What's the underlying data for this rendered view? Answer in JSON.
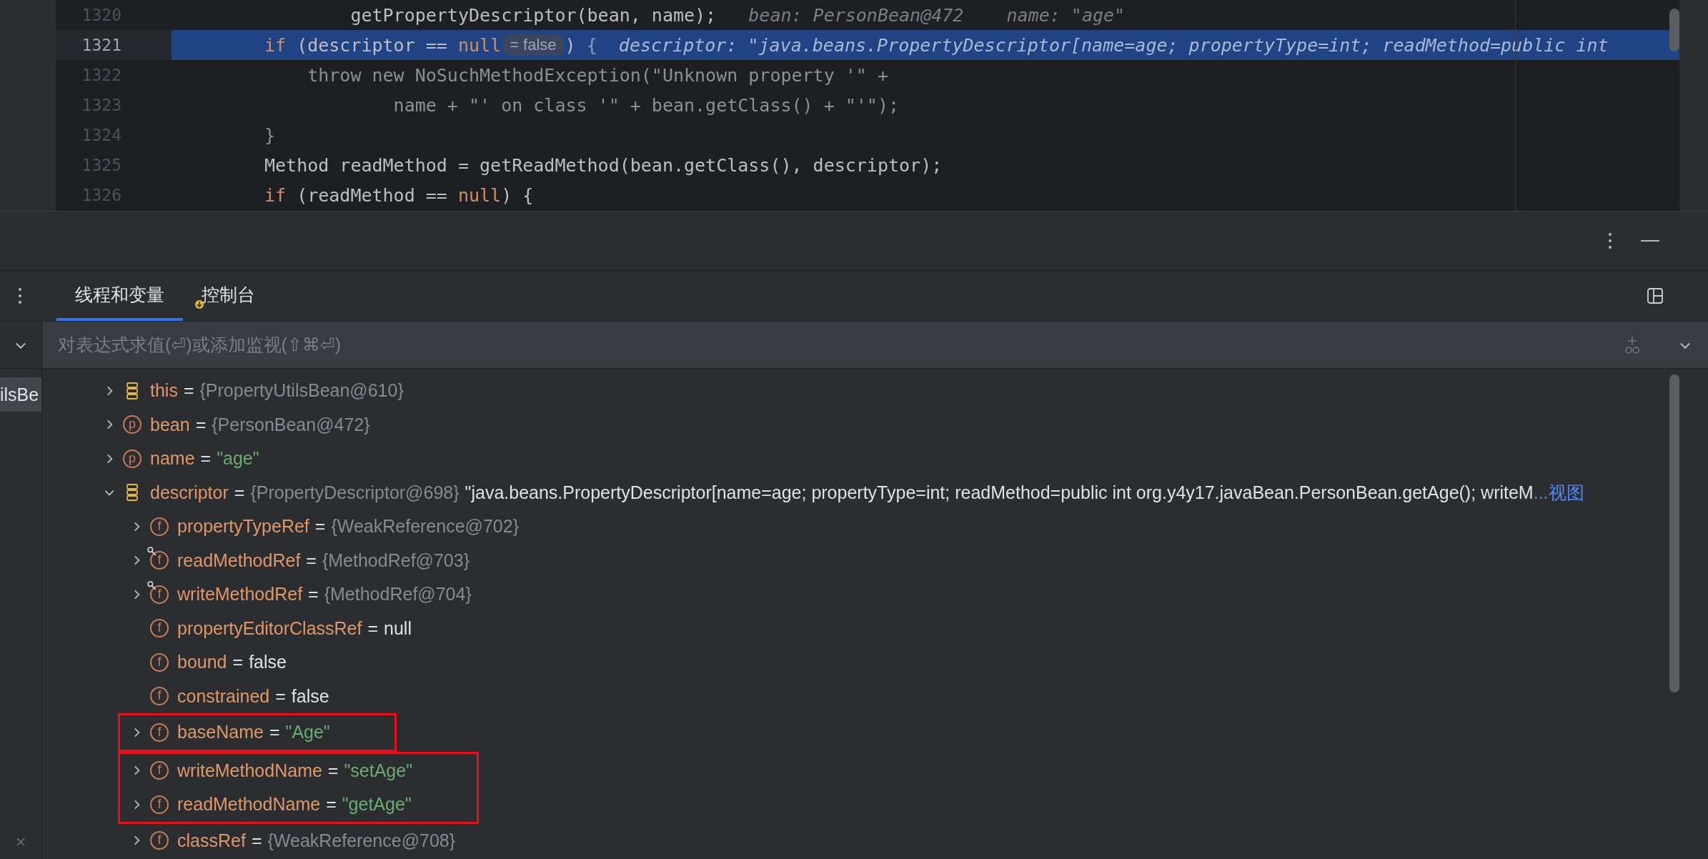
{
  "editor": {
    "lines": [
      {
        "number": "1320",
        "selected": false,
        "tokens": [
          {
            "kind": "code",
            "text": "        getPropertyDescriptor(bean, name);"
          },
          {
            "kind": "hint",
            "text": "   bean: PersonBean@472    name: \"age\""
          }
        ]
      },
      {
        "number": "1321",
        "selected": true,
        "tokens": [
          {
            "kind": "keyword",
            "text": "if"
          },
          {
            "kind": "code",
            "text": " (descriptor == "
          },
          {
            "kind": "keyword",
            "text": "null"
          },
          {
            "kind": "pill",
            "text": "= false"
          },
          {
            "kind": "code",
            "text": ") "
          },
          {
            "kind": "dim",
            "text": "{"
          },
          {
            "kind": "hint",
            "text": "  descriptor: \"java.beans.PropertyDescriptor[name=age; propertyType=int; readMethod=public int"
          }
        ]
      },
      {
        "number": "1322",
        "selected": false,
        "tokens": [
          {
            "kind": "dim",
            "text": "    throw new NoSuchMethodException(\"Unknown property '\" +"
          }
        ]
      },
      {
        "number": "1323",
        "selected": false,
        "tokens": [
          {
            "kind": "dim",
            "text": "            name + \"' on class '\" + bean.getClass() + \"'\");"
          }
        ]
      },
      {
        "number": "1324",
        "selected": false,
        "tokens": [
          {
            "kind": "dim",
            "text": "}"
          }
        ]
      },
      {
        "number": "1325",
        "selected": false,
        "tokens": [
          {
            "kind": "code",
            "text": "Method readMethod = getReadMethod(bean.getClass(), descriptor);"
          }
        ]
      },
      {
        "number": "1326",
        "selected": false,
        "tokens": [
          {
            "kind": "keyword",
            "text": "if"
          },
          {
            "kind": "code",
            "text": " (readMethod == "
          },
          {
            "kind": "keyword",
            "text": "null"
          },
          {
            "kind": "code",
            "text": ") {"
          }
        ]
      }
    ]
  },
  "tabs": [
    {
      "label": "线程和变量",
      "selected": true,
      "badge": false
    },
    {
      "label": "控制台",
      "selected": false,
      "badge": true
    }
  ],
  "watch": {
    "placeholder": "对表达式求值(⏎)或添加监视(⇧⌘⏎)"
  },
  "frames": [
    {
      "label": "ilsBe",
      "selected": true
    }
  ],
  "variables": [
    {
      "kind": "row",
      "icon": {
        "kind": "stack"
      },
      "name": "this",
      "operator": "=",
      "value": {
        "kind": "object",
        "text": "{PropertyUtilsBean@610}"
      },
      "expandable": true,
      "expanded": false,
      "badge": false
    },
    {
      "kind": "row",
      "icon": {
        "kind": "letter",
        "letter": "p"
      },
      "name": "bean",
      "operator": "=",
      "value": {
        "kind": "object",
        "text": "{PersonBean@472}"
      },
      "expandable": true,
      "expanded": false,
      "badge": false
    },
    {
      "kind": "row",
      "icon": {
        "kind": "letter",
        "letter": "p"
      },
      "name": "name",
      "operator": "=",
      "value": {
        "kind": "string",
        "text": "\"age\""
      },
      "expandable": true,
      "expanded": false,
      "badge": false
    },
    {
      "kind": "row",
      "icon": {
        "kind": "stack"
      },
      "name": "descriptor",
      "operator": "=",
      "value": {
        "kind": "object",
        "text": "{PropertyDescriptor@698}"
      },
      "description": "\"java.beans.PropertyDescriptor[name=age; propertyType=int; readMethod=public int org.y4y17.javaBean.PersonBean.getAge(); writeM",
      "more_link": "...视图",
      "expandable": true,
      "expanded": true,
      "badge": false,
      "children": [
        {
          "kind": "row",
          "icon": {
            "kind": "letter",
            "letter": "f"
          },
          "name": "propertyTypeRef",
          "operator": "=",
          "value": {
            "kind": "object",
            "text": "{WeakReference@702}"
          },
          "expandable": true,
          "expanded": false,
          "badge": false
        },
        {
          "kind": "row",
          "icon": {
            "kind": "letter",
            "letter": "f"
          },
          "name": "readMethodRef",
          "operator": "=",
          "value": {
            "kind": "object",
            "text": "{MethodRef@703}"
          },
          "expandable": true,
          "expanded": false,
          "badge": true
        },
        {
          "kind": "row",
          "icon": {
            "kind": "letter",
            "letter": "f"
          },
          "name": "writeMethodRef",
          "operator": "=",
          "value": {
            "kind": "object",
            "text": "{MethodRef@704}"
          },
          "expandable": true,
          "expanded": false,
          "badge": true
        },
        {
          "kind": "row",
          "icon": {
            "kind": "letter",
            "letter": "f"
          },
          "name": "propertyEditorClassRef",
          "operator": "=",
          "value": {
            "kind": "literal",
            "text": "null"
          },
          "expandable": false,
          "expanded": false,
          "badge": false
        },
        {
          "kind": "row",
          "icon": {
            "kind": "letter",
            "letter": "f"
          },
          "name": "bound",
          "operator": "=",
          "value": {
            "kind": "literal",
            "text": "false"
          },
          "expandable": false,
          "expanded": false,
          "badge": false
        },
        {
          "kind": "row",
          "icon": {
            "kind": "letter",
            "letter": "f"
          },
          "name": "constrained",
          "operator": "=",
          "value": {
            "kind": "literal",
            "text": "false"
          },
          "expandable": false,
          "expanded": false,
          "badge": false
        },
        {
          "kind": "annotation",
          "rows": [
            {
              "kind": "row",
              "icon": {
                "kind": "letter",
                "letter": "f"
              },
              "name": "baseName",
              "operator": "=",
              "value": {
                "kind": "string",
                "text": "\"Age\""
              },
              "expandable": true,
              "expanded": false,
              "badge": false
            }
          ]
        },
        {
          "kind": "annotation",
          "rows": [
            {
              "kind": "row",
              "icon": {
                "kind": "letter",
                "letter": "f"
              },
              "name": "writeMethodName",
              "operator": "=",
              "value": {
                "kind": "string",
                "text": "\"setAge\""
              },
              "expandable": true,
              "expanded": false,
              "badge": false
            },
            {
              "kind": "row",
              "icon": {
                "kind": "letter",
                "letter": "f"
              },
              "name": "readMethodName",
              "operator": "=",
              "value": {
                "kind": "string",
                "text": "\"getAge\""
              },
              "expandable": true,
              "expanded": false,
              "badge": false
            }
          ]
        },
        {
          "kind": "row",
          "icon": {
            "kind": "letter",
            "letter": "f"
          },
          "name": "classRef",
          "operator": "=",
          "value": {
            "kind": "object",
            "text": "{WeakReference@708}"
          },
          "expandable": true,
          "expanded": false,
          "badge": false
        }
      ]
    }
  ]
}
